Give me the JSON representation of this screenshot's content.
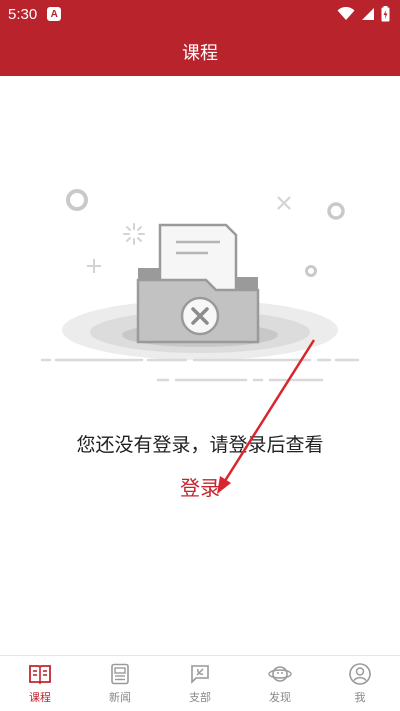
{
  "status_bar": {
    "time": "5:30",
    "app_icon_letter": "A"
  },
  "header": {
    "title": "课程"
  },
  "empty_state": {
    "message": "您还没有登录，请登录后查看",
    "login_label": "登录"
  },
  "tabs": [
    {
      "label": "课程",
      "icon": "book-icon",
      "active": true
    },
    {
      "label": "新闻",
      "icon": "news-icon",
      "active": false
    },
    {
      "label": "支部",
      "icon": "party-flag-icon",
      "active": false
    },
    {
      "label": "发现",
      "icon": "planet-icon",
      "active": false
    },
    {
      "label": "我",
      "icon": "user-icon",
      "active": false
    }
  ],
  "colors": {
    "brand": "#b8232c",
    "accent": "#c4252d",
    "inactive": "#888888"
  }
}
